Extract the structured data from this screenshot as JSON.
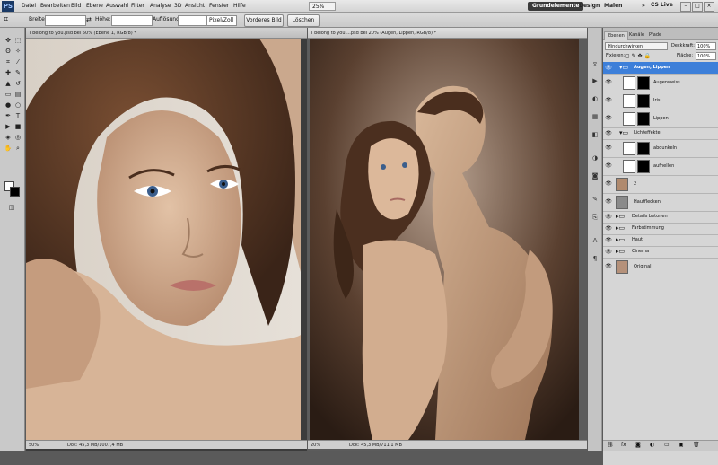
{
  "app": {
    "logo": "PS"
  },
  "menubar": {
    "items": [
      "Datei",
      "Bearbeiten",
      "Bild",
      "Ebene",
      "Auswahl",
      "Filter",
      "Analyse",
      "3D",
      "Ansicht",
      "Fenster",
      "Hilfe"
    ],
    "zoom": "25%",
    "workspaces": [
      "Grundelemente",
      "Design",
      "Malen"
    ],
    "more": "»",
    "cs_live": "CS Live",
    "window_buttons": [
      "–",
      "□",
      "×"
    ]
  },
  "optbar": {
    "breite_label": "Breite:",
    "hoehe_label": "Höhe:",
    "aufloesung_label": "Auflösung:",
    "unit_value": "Pixel/Zoll",
    "vorderes_bild": "Vorderes Bild",
    "loeschen": "Löschen"
  },
  "docs": [
    {
      "tab": "I belong to you.psd bei 50% (Ebene 1, RGB/8) *",
      "zoom": "50%",
      "info": "Dok: 45,3 MB/1007,4 MB"
    },
    {
      "tab": "I belong to you....psd bei 20% (Augen, Lippen, RGB/8) *",
      "zoom": "20%",
      "info": "Dok: 45,3 MB/711,1 MB"
    }
  ],
  "panel": {
    "tabs": [
      "Ebenen",
      "Kanäle",
      "Pfade"
    ],
    "blend_mode": "Hindurchwirken",
    "opacity_label": "Deckkraft:",
    "opacity_value": "100%",
    "fix_label": "Fixieren:",
    "fill_label": "Fläche:",
    "fill_value": "100%"
  },
  "layers": [
    {
      "name": "Augen, Lippen",
      "type": "group-open",
      "selected": true
    },
    {
      "name": "Augenweiss",
      "type": "adjust-mask"
    },
    {
      "name": "Iris",
      "type": "adjust-mask"
    },
    {
      "name": "Lippen",
      "type": "adjust-mask"
    },
    {
      "name": "Lichteffekte",
      "type": "group-open"
    },
    {
      "name": "abdunkeln",
      "type": "adjust-mask"
    },
    {
      "name": "aufhellen",
      "type": "adjust-mask"
    },
    {
      "name": "2",
      "type": "image"
    },
    {
      "name": "Hautflecken",
      "type": "image"
    },
    {
      "name": "Details betonen",
      "type": "group"
    },
    {
      "name": "Farbstimmung",
      "type": "group"
    },
    {
      "name": "Haut",
      "type": "group"
    },
    {
      "name": "Cinema",
      "type": "group"
    },
    {
      "name": "Original",
      "type": "image"
    }
  ],
  "colors": {
    "accent": "#3d7fd9",
    "selected_layer": "#3d7fd9"
  }
}
